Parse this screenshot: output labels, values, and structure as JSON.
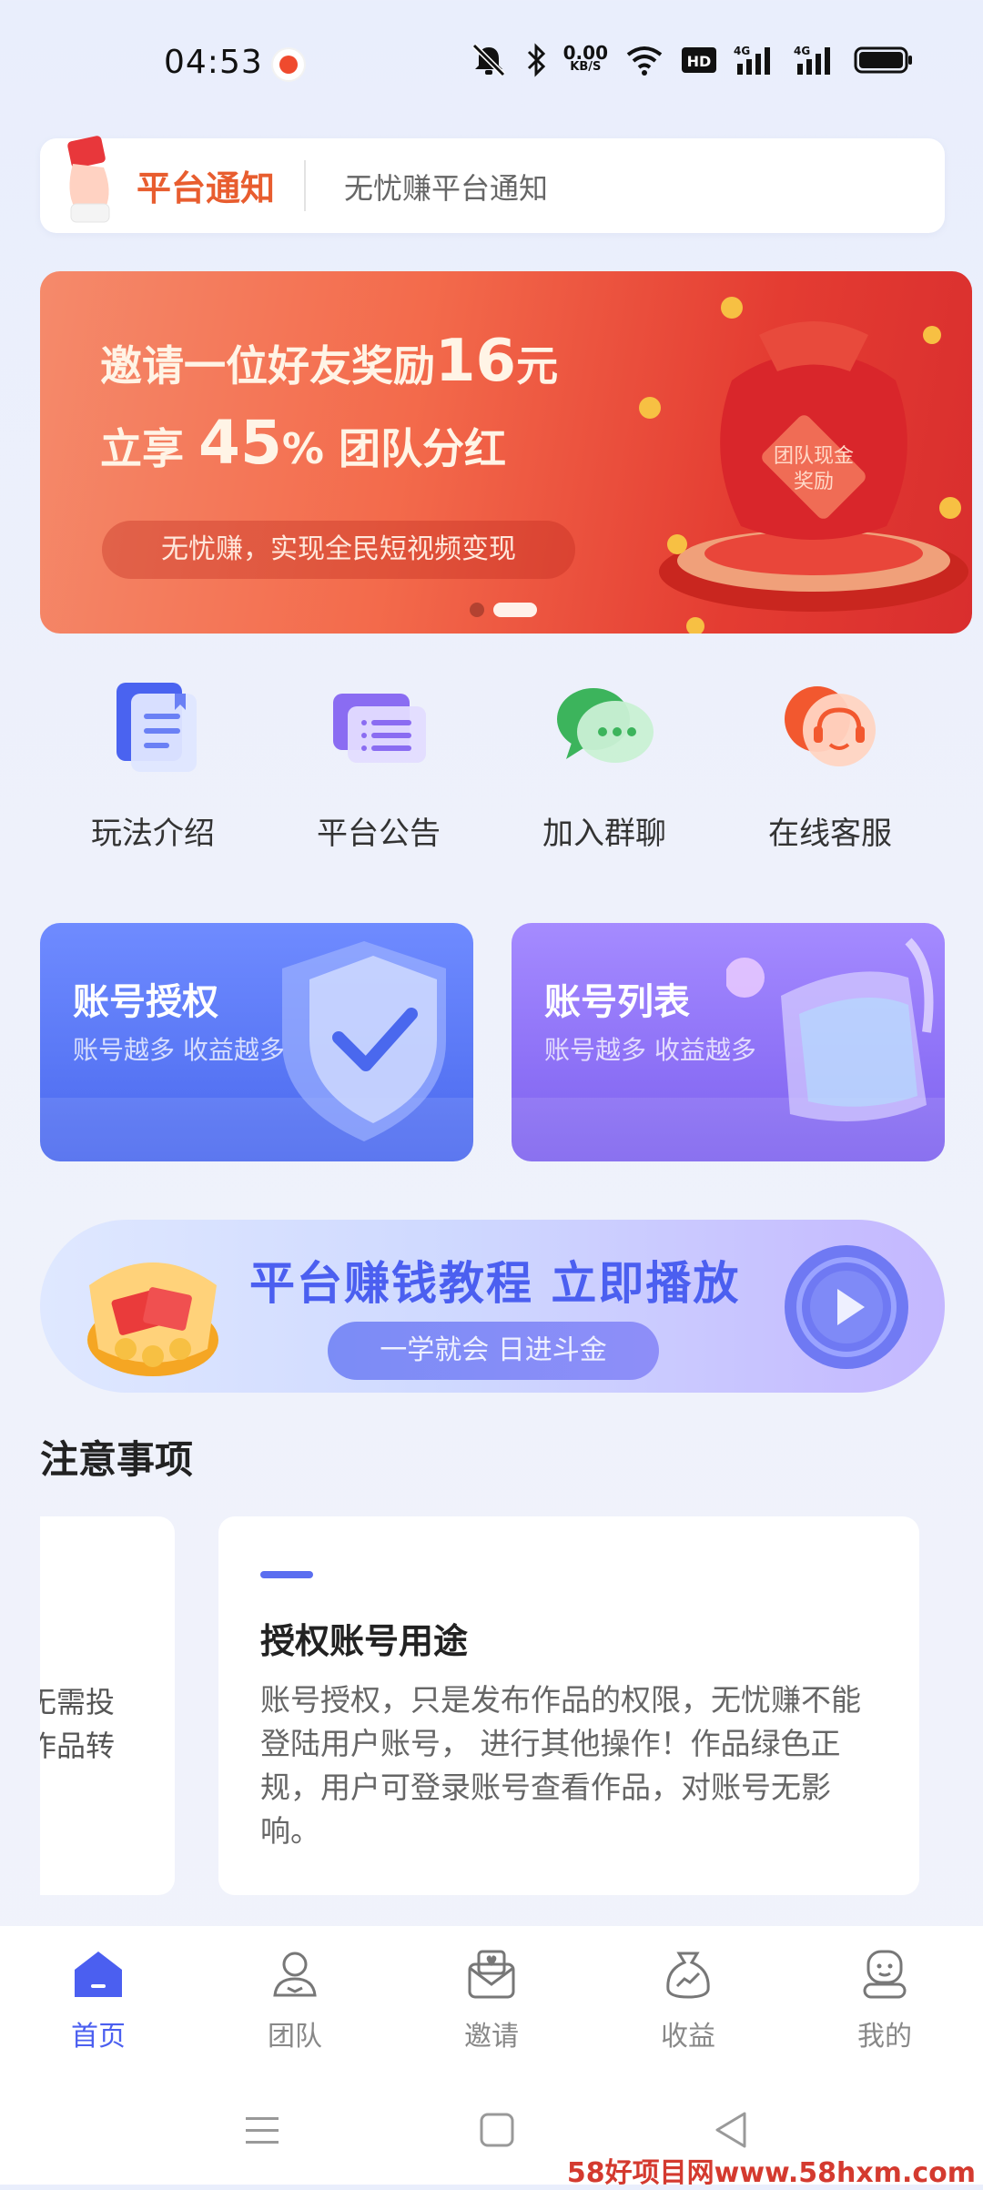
{
  "status_bar": {
    "time": "04:53",
    "net_speed_value": "0.00",
    "net_speed_unit": "KB/S",
    "hd_label": "HD",
    "signal1_label": "4G",
    "signal2_label": "4G",
    "icons": [
      "mute-icon",
      "bluetooth-icon",
      "wifi-icon",
      "hd-icon",
      "signal-icon",
      "signal-icon",
      "battery-icon"
    ]
  },
  "notice": {
    "title": "平台通知",
    "text": "无忧赚平台通知"
  },
  "banner": {
    "line1_prefix": "邀请一位好友奖励",
    "line1_amount": "16",
    "line1_suffix": "元",
    "line2_prefix": "立享",
    "line2_percent": "45",
    "line2_percent_sign": "%",
    "line2_suffix": "团队分红",
    "pill": "无忧赚，实现全民短视频变现",
    "bag_label_1": "团队现金",
    "bag_label_2": "奖励",
    "dots": 2,
    "active_dot": 1
  },
  "quick_actions": [
    {
      "label": "玩法介绍",
      "icon": "guide-doc-icon"
    },
    {
      "label": "平台公告",
      "icon": "announcement-icon"
    },
    {
      "label": "加入群聊",
      "icon": "group-chat-icon"
    },
    {
      "label": "在线客服",
      "icon": "customer-service-icon"
    }
  ],
  "account_cards": [
    {
      "title": "账号授权",
      "subtitle": "账号越多 收益越多",
      "icon": "shield-check-icon"
    },
    {
      "title": "账号列表",
      "subtitle": "账号越多 收益越多",
      "icon": "list-scroll-icon"
    }
  ],
  "tutorial": {
    "title": "平台赚钱教程 立即播放",
    "pill": "一学就会 日进斗金",
    "icon": "play-icon"
  },
  "notes": {
    "heading": "注意事项",
    "left_partial_lines": [
      "无需投",
      "作品转"
    ],
    "card_title": "授权账号用途",
    "card_body": "账号授权，只是发布作品的权限，无忧赚不能登陆用户账号， 进行其他操作！作品绿色正规，用户可登录账号查看作品，对账号无影响。"
  },
  "tabs": [
    {
      "label": "首页",
      "icon": "home-icon",
      "active": true
    },
    {
      "label": "团队",
      "icon": "team-icon",
      "active": false
    },
    {
      "label": "邀请",
      "icon": "invite-icon",
      "active": false
    },
    {
      "label": "收益",
      "icon": "income-icon",
      "active": false
    },
    {
      "label": "我的",
      "icon": "profile-icon",
      "active": false
    }
  ],
  "watermark": "58好项目网www.58hxm.com",
  "colors": {
    "accent_blue": "#4b5ff0",
    "notice_orange": "#e85d2f",
    "banner_red": "#e43c32"
  }
}
